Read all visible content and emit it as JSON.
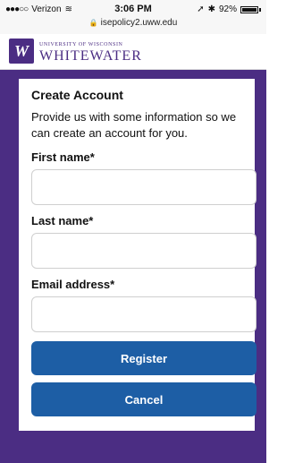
{
  "status_bar": {
    "carrier": "Verizon",
    "time": "3:06 PM",
    "battery": "92%",
    "url": "isepolicy2.uww.edu"
  },
  "logo": {
    "small_text": "UNIVERSITY OF WISCONSIN",
    "big_text": "WHITEWATER",
    "mark": "W"
  },
  "form": {
    "title": "Create Account",
    "description": "Provide us with some information so we can create an account for you.",
    "fields": [
      {
        "label": "First name*",
        "value": "",
        "placeholder": ""
      },
      {
        "label": "Last name*",
        "value": "",
        "placeholder": ""
      },
      {
        "label": "Email address*",
        "value": "",
        "placeholder": ""
      }
    ],
    "buttons": {
      "register": "Register",
      "cancel": "Cancel"
    }
  },
  "colors": {
    "brand_purple": "#4b2d83",
    "button_blue": "#1d5ea5"
  }
}
